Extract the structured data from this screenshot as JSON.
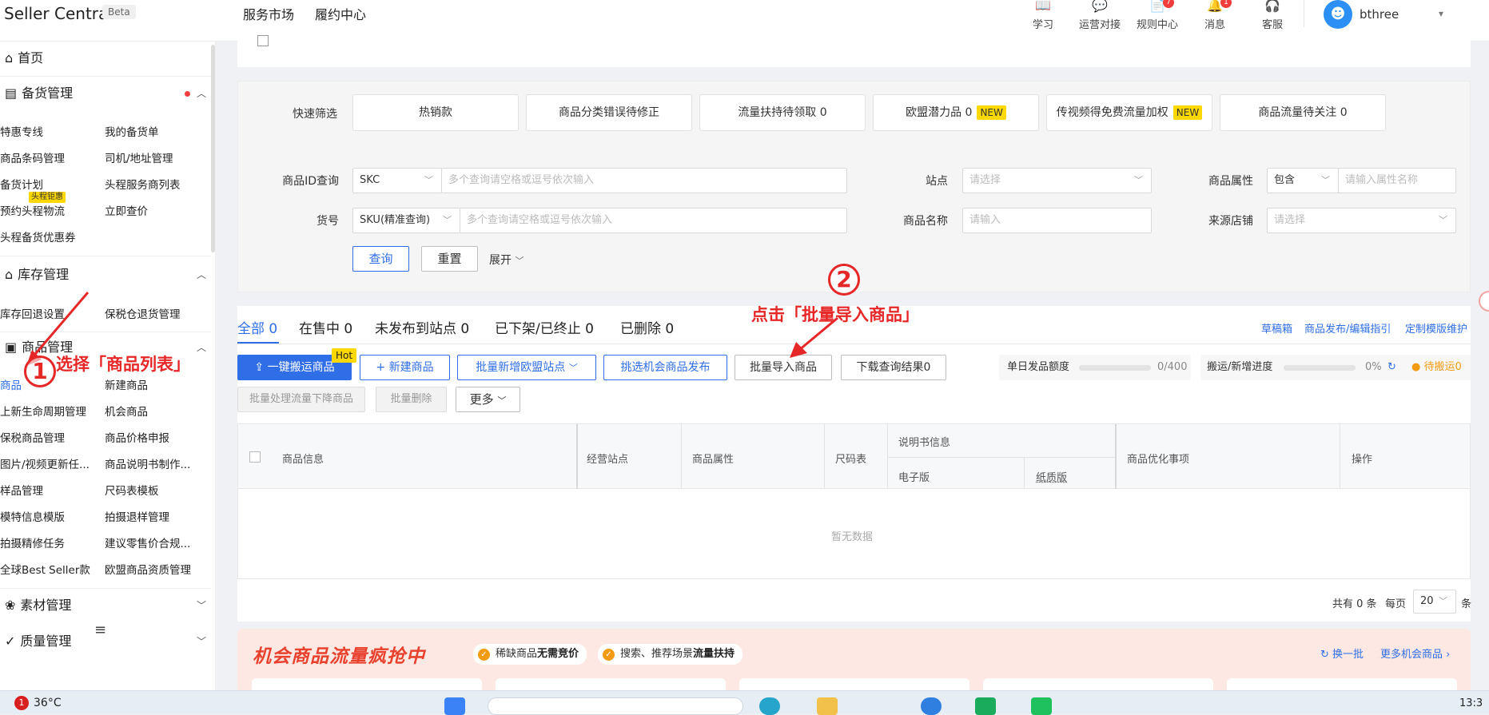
{
  "header": {
    "brand": "Seller Central",
    "beta": "Beta",
    "nav": [
      "服务市场",
      "履约中心"
    ],
    "icons": [
      {
        "label": "学习",
        "badge": ""
      },
      {
        "label": "运营对接",
        "badge": ""
      },
      {
        "label": "规则中心",
        "badge": "7"
      },
      {
        "label": "消息",
        "badge": "1"
      },
      {
        "label": "客服",
        "badge": ""
      }
    ],
    "user": "bthree",
    "avatar_glyph": "☻"
  },
  "sidebar": {
    "home": "首页",
    "groups": {
      "stock": "备货管理",
      "inventory": "库存管理",
      "product": "商品管理",
      "material": "素材管理",
      "quality": "质量管理"
    },
    "stock_items": [
      "特惠专线",
      "我的备货单",
      "商品条码管理",
      "司机/地址管理",
      "备货计划",
      "头程服务商列表",
      "预约头程物流",
      "立即查价",
      "头程备货优惠券"
    ],
    "stock_badge": "头程钜惠",
    "inventory_items": [
      "库存回退设置",
      "保税仓退货管理"
    ],
    "product_items": [
      "商品",
      "新建商品",
      "上新生命周期管理",
      "机会商品",
      "保税商品管理",
      "商品价格申报",
      "图片/视频更新任...",
      "商品说明书制作...",
      "样品管理",
      "尺码表模板",
      "模特信息模版",
      "拍摄退样管理",
      "拍摄精修任务",
      "建议零售价合规...",
      "全球Best Seller款",
      "欧盟商品资质管理"
    ],
    "bottom_icon": "≡"
  },
  "quick_filter": {
    "label": "快速筛选",
    "chips": [
      {
        "text": "热销款",
        "tag": ""
      },
      {
        "text": "商品分类错误待修正",
        "tag": ""
      },
      {
        "text": "流量扶持待领取 0",
        "tag": ""
      },
      {
        "text": "欧盟潜力品 0",
        "tag": "NEW"
      },
      {
        "text": "传视频得免费流量加权",
        "tag": "NEW"
      },
      {
        "text": "商品流量待关注 0",
        "tag": ""
      }
    ]
  },
  "search": {
    "product_id_label": "商品ID查询",
    "product_id_type": "SKC",
    "product_id_placeholder": "多个查询请空格或逗号依次输入",
    "sku_label": "货号",
    "sku_type": "SKU(精准查询)",
    "sku_placeholder": "多个查询请空格或逗号依次输入",
    "site_label": "站点",
    "site_placeholder": "请选择",
    "name_label": "商品名称",
    "name_placeholder": "请输入",
    "attr_label": "商品属性",
    "attr_type": "包含",
    "attr_placeholder": "请输入属性名称",
    "shop_label": "来源店铺",
    "shop_placeholder": "请选择",
    "query_btn": "查询",
    "reset_btn": "重置",
    "expand": "展开"
  },
  "tabs": [
    "全部 0",
    "在售中 0",
    "未发布到站点 0",
    "已下架/已终止 0",
    "已删除 0"
  ],
  "right_links": [
    "草稿箱",
    "商品发布/编辑指引",
    "定制模版维护"
  ],
  "toolbar": {
    "one_click": "一键搬运商品",
    "hot": "Hot",
    "new_product": "+ 新建商品",
    "batch_eu": "批量新增欧盟站点",
    "pick_chance": "挑选机会商品发布",
    "batch_import": "批量导入商品",
    "download": "下载查询结果0",
    "batch_traffic": "批量处理流量下降商品",
    "batch_delete": "批量删除",
    "more": "更多"
  },
  "progress": {
    "daily_label": "单日发品额度",
    "daily_value": "0/400",
    "daily_fraction": 0,
    "move_label": "搬运/新增进度",
    "move_value": "0%",
    "move_fraction": 0,
    "pending": "待搬运0"
  },
  "table": {
    "headers": [
      "商品信息",
      "经营站点",
      "商品属性",
      "尺码表",
      "说明书信息",
      "电子版",
      "纸质版",
      "商品优化事项",
      "操作"
    ],
    "empty": "暂无数据"
  },
  "pagination": {
    "total": "共有 0 条",
    "per_page_label": "每页",
    "per_page": "20",
    "unit": "条"
  },
  "promo": {
    "title": "机会商品流量疯抢中",
    "tag1_prefix": "稀缺商品",
    "tag1_bold": "无需竞价",
    "tag2_prefix": "搜索、推荐场景",
    "tag2_bold": "流量扶持",
    "refresh": "换一批",
    "more": "更多机会商品"
  },
  "annotations": {
    "step1_num": "1",
    "step1_text": "选择「商品列表」",
    "step2_num": "2",
    "step2_text": "点击「批量导入商品」",
    "accent": "#e62727"
  },
  "taskbar": {
    "temp": "36°C",
    "alert": "1",
    "clock": "13:3"
  },
  "colors": {
    "primary": "#2f6ee6",
    "badge": "#ffd800",
    "alert": "#f23d3d",
    "warning": "#f29b12"
  }
}
